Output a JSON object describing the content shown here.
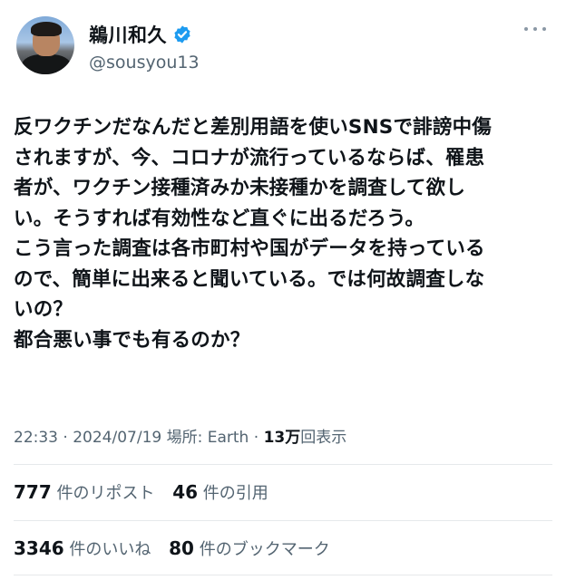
{
  "user": {
    "display_name": "鵜川和久",
    "handle": "@sousyou13",
    "verified": true
  },
  "tweet": {
    "lines": [
      "反ワクチンだなんだと差別用語を使いSNSで誹謗中傷",
      "されますが、今、コロナが流行っているならば、罹患",
      "者が、ワクチン接種済みか未接種かを調査して欲し",
      "い。そうすれば有効性など直ぐに出るだろう。",
      "こう言った調査は各市町村や国がデータを持っている",
      "ので、簡単に出来ると聞いている。では何故調査しな",
      "いの？",
      "都合悪い事でも有るのか？"
    ]
  },
  "meta": {
    "time": "22:33",
    "date": "2024/07/19",
    "location": "場所: Earth",
    "views_count": "13万",
    "views_label": "回表示",
    "separator": " · "
  },
  "stats": {
    "reposts_count": "777",
    "reposts_label": "件のリポスト",
    "quotes_count": "46",
    "quotes_label": "件の引用",
    "likes_count": "3346",
    "likes_label": "件のいいね",
    "bookmarks_count": "80",
    "bookmarks_label": "件のブックマーク"
  },
  "colors": {
    "text": "#0f1419",
    "secondary": "#536471",
    "verified": "#1d9bf0",
    "divider": "#e6e9eb"
  }
}
